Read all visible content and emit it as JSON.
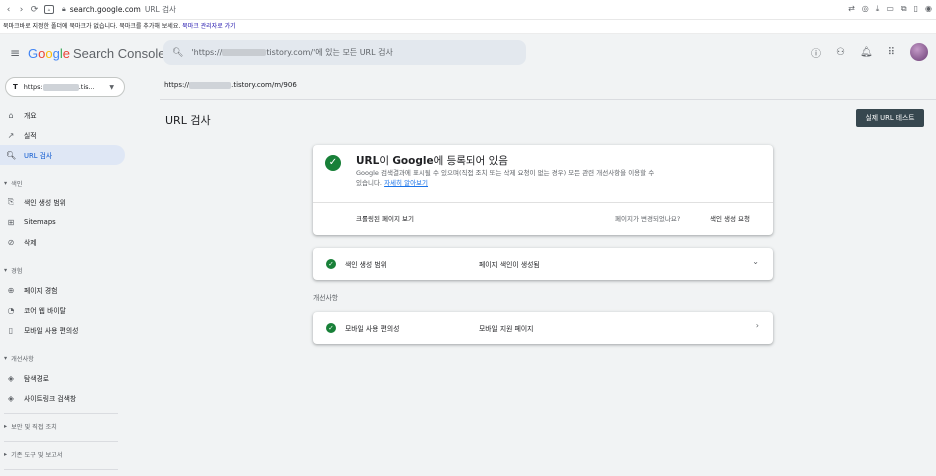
{
  "browser": {
    "url_host": "search.google.com",
    "url_title": "URL 검사",
    "bookmark_message": "북마크바로 지정한 폴더에 북마크가 없습니다. 북마크를 추가해 보세요.",
    "bookmark_link": "북마크 관리자로 가기"
  },
  "header": {
    "brand": {
      "g1": "G",
      "o1": "o",
      "o2": "o",
      "g2": "g",
      "l": "l",
      "e": "e",
      "suffix": "Search Console"
    },
    "search_prefix": "'https://",
    "search_suffix": "tistory.com/'에 있는 모든 URL 검사"
  },
  "sidebar": {
    "property_prefix": "https:",
    "property_suffix": ".tis...",
    "items": [
      {
        "label": "개요",
        "icon": "home-icon"
      },
      {
        "label": "실적",
        "icon": "trending-icon"
      },
      {
        "label": "URL 검사",
        "icon": "search-icon",
        "active": true
      }
    ],
    "sections": {
      "index": "색인",
      "experience": "경험",
      "enhancements": "개선사항",
      "security": "보안 및 직접 조치",
      "legacy": "기존 도구 및 보고서"
    },
    "index_items": [
      "색인 생성 범위",
      "Sitemaps",
      "삭제"
    ],
    "experience_items": [
      "페이지 경험",
      "코어 웹 바이탈",
      "모바일 사용 편의성"
    ],
    "enhancement_items": [
      "탐색경로",
      "사이트링크 검색창"
    ]
  },
  "main": {
    "crumb_prefix": "https://",
    "crumb_suffix": ".tistory.com/m/906",
    "title": "URL 검사",
    "live_test_button": "실제 URL 테스트",
    "status": {
      "title_b": "URL",
      "title_rest_1": "이 ",
      "title_b2": "Google",
      "title_rest_2": "에 등록되어 있음",
      "desc": "Google 검색결과에 표시될 수 있으며(직접 조치 또는 삭제 요청이 없는 경우) 모든 관련 개선사항을 이용할 수 있습니다.",
      "learn_more": "자세히 알아보기",
      "crawled_page": "크롤링된 페이지 보기",
      "changed_question": "페이지가 변경되었나요?",
      "request_indexing": "색인 생성 요청"
    },
    "coverage": {
      "label": "색인 생성 범위",
      "value": "페이지 색인이 생성됨"
    },
    "enhancements_label": "개선사항",
    "mobile": {
      "label": "모바일 사용 편의성",
      "value": "모바일 지원 페이지"
    }
  },
  "colors": {
    "accent": "#0b57d0",
    "success": "#188038",
    "button_dark": "#37474f"
  }
}
